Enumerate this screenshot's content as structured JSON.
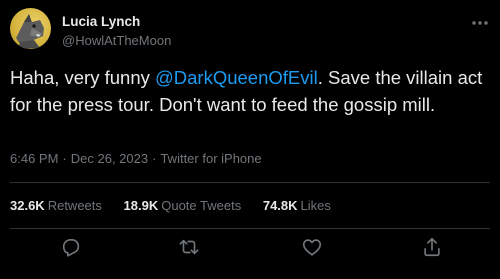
{
  "author": {
    "display_name": "Lucia Lynch",
    "handle": "@HowlAtTheMoon"
  },
  "tweet": {
    "text_before": "Haha, very funny ",
    "mention": "@DarkQueenOfEvil",
    "text_after": ". Save the villain act for the press tour. Don't want to feed the gossip mill."
  },
  "meta": {
    "time": "6:46 PM",
    "separator": "·",
    "date": "Dec 26, 2023",
    "source": "Twitter for iPhone"
  },
  "stats": {
    "retweets_count": "32.6K",
    "retweets_label": "Retweets",
    "quotes_count": "18.9K",
    "quotes_label": "Quote Tweets",
    "likes_count": "74.8K",
    "likes_label": "Likes"
  },
  "icons": {
    "more": "more-horizontal-icon",
    "reply": "reply-icon",
    "retweet": "retweet-icon",
    "like": "heart-icon",
    "share": "share-icon"
  },
  "colors": {
    "background": "#000000",
    "text": "#e7e9ea",
    "secondary": "#71767b",
    "accent": "#1d9bf0",
    "divider": "#2f3336"
  }
}
